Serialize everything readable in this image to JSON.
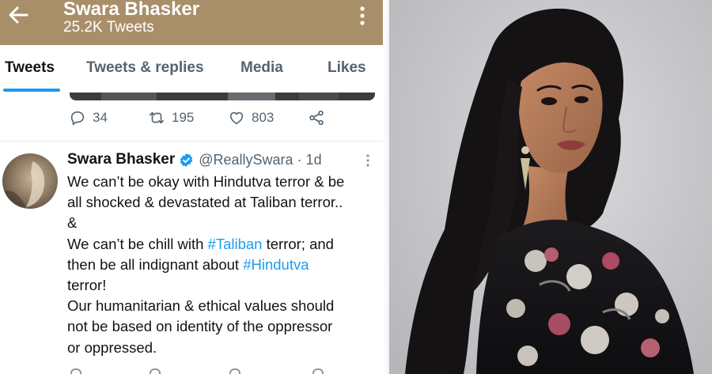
{
  "header": {
    "title": "Swara Bhasker",
    "subtitle": "25.2K Tweets",
    "back_icon": "arrow-left-icon",
    "more_icon": "vertical-dots-icon",
    "bar_color": "#a98f69"
  },
  "tabs": [
    {
      "label": "Tweets",
      "active": true
    },
    {
      "label": "Tweets & replies",
      "active": false
    },
    {
      "label": "Media",
      "active": false
    },
    {
      "label": "Likes",
      "active": false
    }
  ],
  "previous_tweet": {
    "replies": "34",
    "retweets": "195",
    "likes": "803"
  },
  "tweet": {
    "name": "Swara Bhasker",
    "handle": "@ReallySwara · 1d",
    "lines": [
      {
        "text": "We can’t be okay with Hindutva terror & be"
      },
      {
        "text": "all shocked & devastated at Taliban terror.."
      },
      {
        "text": "&"
      },
      {
        "before": "We can’t be chill with ",
        "tag": "#Taliban",
        "after": " terror; and"
      },
      {
        "before": "then be all indignant about ",
        "tag": "#Hindutva",
        "after": ""
      },
      {
        "text": "terror!"
      },
      {
        "text": "Our humanitarian & ethical values should"
      },
      {
        "text": "not be based on identity of the oppressor"
      },
      {
        "text": "or oppressed."
      }
    ]
  },
  "colors": {
    "accent": "#1d9bf0",
    "muted_text": "#536471",
    "text": "#0f1419"
  },
  "photo": {
    "subject": "portrait-photo"
  }
}
